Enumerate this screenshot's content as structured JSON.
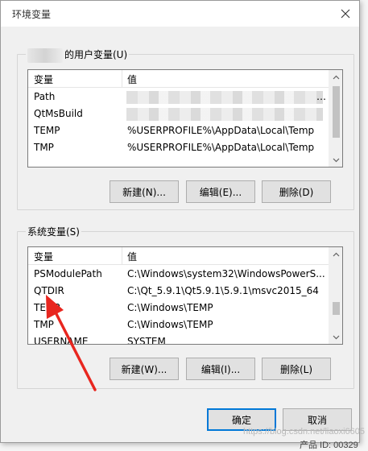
{
  "dialog": {
    "title": "环境变量",
    "close_glyph": "✕"
  },
  "user_group": {
    "label": "的用户变量(U)",
    "header": {
      "name": "变量",
      "value": "值"
    },
    "rows": [
      {
        "name": "Path",
        "value": ""
      },
      {
        "name": "QtMsBuild",
        "value": ""
      },
      {
        "name": "TEMP",
        "value": "%USERPROFILE%\\AppData\\Local\\Temp"
      },
      {
        "name": "TMP",
        "value": "%USERPROFILE%\\AppData\\Local\\Temp"
      }
    ],
    "buttons": {
      "new": "新建(N)...",
      "edit": "编辑(E)...",
      "delete": "删除(D)"
    }
  },
  "system_group": {
    "label": "系统变量(S)",
    "header": {
      "name": "变量",
      "value": "值"
    },
    "rows": [
      {
        "name": "PSModulePath",
        "value": "C:\\Windows\\system32\\WindowsPowerS..."
      },
      {
        "name": "QTDIR",
        "value": "C:\\Qt_5.9.1\\Qt5.9.1\\5.9.1\\msvc2015_64"
      },
      {
        "name": "TEMP",
        "value": "C:\\Windows\\TEMP"
      },
      {
        "name": "TMP",
        "value": "C:\\Windows\\TEMP"
      },
      {
        "name": "USERNAME",
        "value": "SYSTEM"
      }
    ],
    "buttons": {
      "new": "新建(W)...",
      "edit": "编辑(I)...",
      "delete": "删除(L)"
    }
  },
  "footer": {
    "ok": "确定",
    "cancel": "取消"
  },
  "watermark": "https://blog.csdn.net/liaoxi6605",
  "bottom_text": "产品 ID: 00329",
  "colors": {
    "arrow": "#e8261f",
    "accent": "#0078d7"
  }
}
